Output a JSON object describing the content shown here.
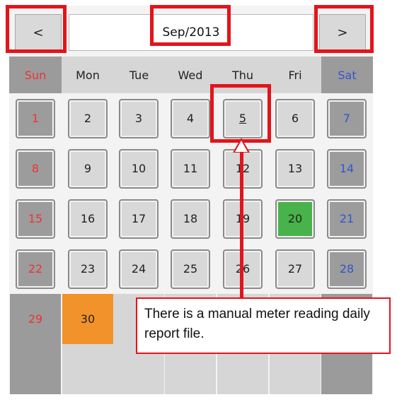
{
  "header": {
    "prev_label": "<",
    "next_label": ">",
    "month_year": "Sep/2013"
  },
  "weekdays": [
    "Sun",
    "Mon",
    "Tue",
    "Wed",
    "Thu",
    "Fri",
    "Sat"
  ],
  "days": {
    "d1": "1",
    "d2": "2",
    "d3": "3",
    "d4": "4",
    "d5": "5",
    "d6": "6",
    "d7": "7",
    "d8": "8",
    "d9": "9",
    "d10": "10",
    "d11": "11",
    "d12": "12",
    "d13": "13",
    "d14": "14",
    "d15": "15",
    "d16": "16",
    "d17": "17",
    "d18": "18",
    "d19": "19",
    "d20": "20",
    "d21": "21",
    "d22": "22",
    "d23": "23",
    "d24": "24",
    "d25": "25",
    "d26": "26",
    "d27": "27",
    "d28": "28",
    "d29": "29",
    "d30": "30"
  },
  "callout": {
    "text": "There is a manual meter reading daily report file."
  },
  "colors": {
    "highlight": "#e3141b",
    "selected_day": "#47b34a",
    "today_cell": "#f2922a",
    "sunday": "#e33333",
    "saturday": "#3355cc"
  }
}
